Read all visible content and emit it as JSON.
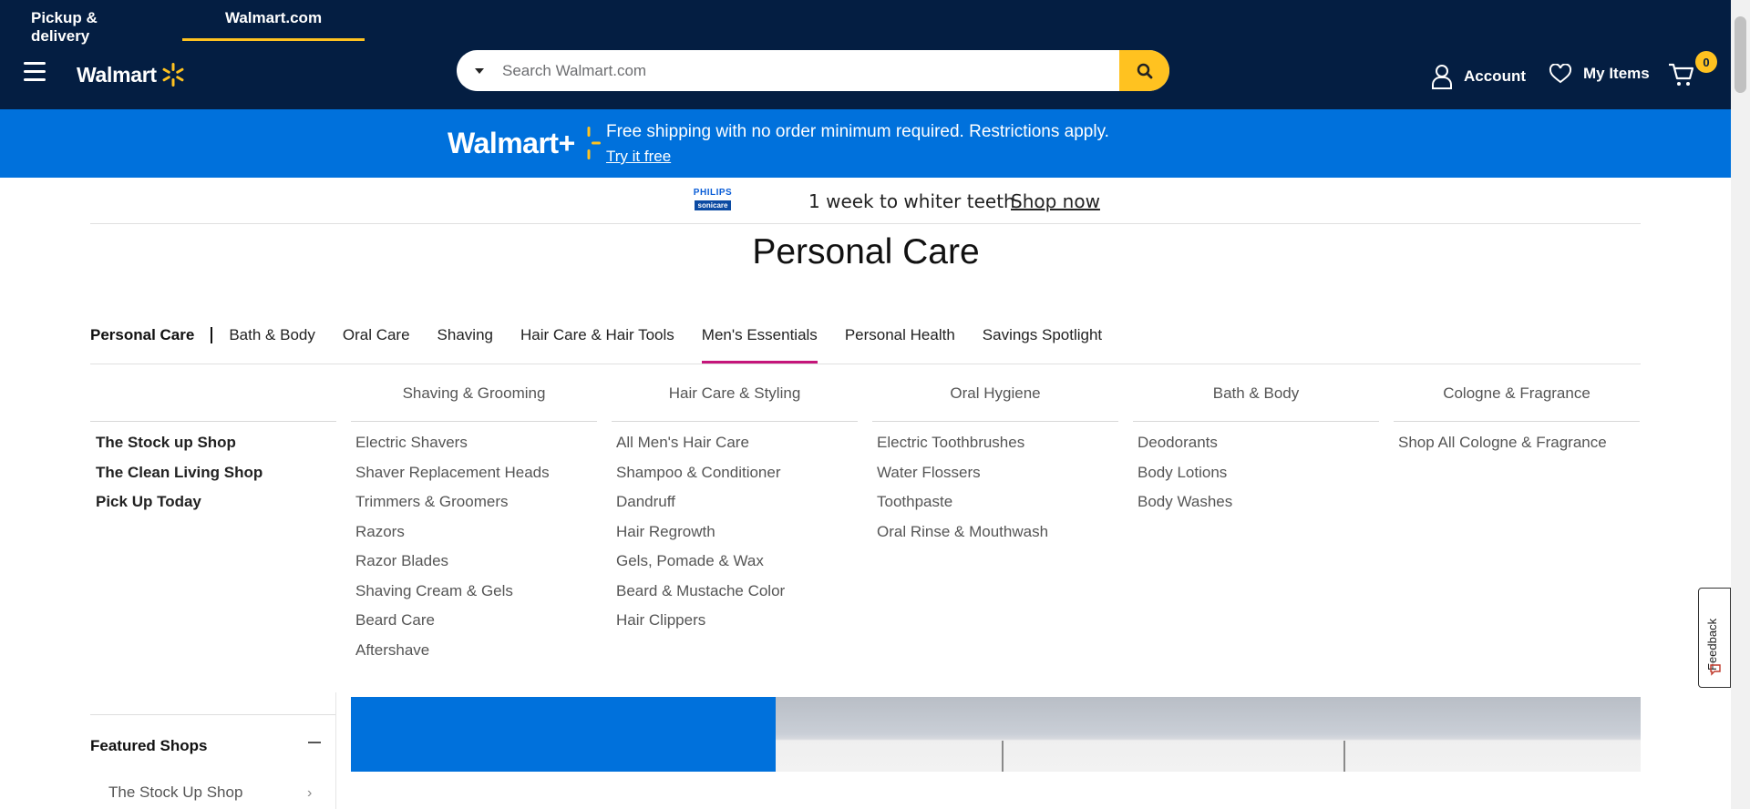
{
  "header": {
    "tabs": [
      {
        "label": "Pickup & delivery"
      },
      {
        "label": "Walmart.com"
      }
    ],
    "brand": "Walmart",
    "search_placeholder": "Search Walmart.com",
    "account_label": "Account",
    "my_items_label": "My Items",
    "cart_count": "0",
    "colors": {
      "navy": "#041e42",
      "yellow": "#ffc220",
      "blue": "#0071dc"
    }
  },
  "promo": {
    "logo_text": "Walmart+",
    "message": "Free shipping with no order minimum required. Restrictions apply.",
    "link": "Try it free"
  },
  "ad": {
    "brand_line1": "PHILIPS",
    "brand_line2": "sonicare",
    "text": "1 week to whiter teeth",
    "link": "Shop now"
  },
  "page_title": "Personal Care",
  "category_nav": {
    "root": "Personal Care",
    "items": [
      "Bath & Body",
      "Oral Care",
      "Shaving",
      "Hair Care & Hair Tools",
      "Men's Essentials",
      "Personal Health",
      "Savings Spotlight"
    ],
    "active": "Men's Essentials"
  },
  "mega_menu": {
    "side_links": [
      "The Stock up Shop",
      "The Clean Living Shop",
      "Pick Up Today"
    ],
    "columns": [
      {
        "heading": "Shaving & Grooming",
        "items": [
          "Electric Shavers",
          "Shaver Replacement Heads",
          "Trimmers & Groomers",
          "Razors",
          "Razor Blades",
          "Shaving Cream & Gels",
          "Beard Care",
          "Aftershave"
        ]
      },
      {
        "heading": "Hair Care & Styling",
        "items": [
          "All Men's Hair Care",
          "Shampoo & Conditioner",
          "Dandruff",
          "Hair Regrowth",
          "Gels, Pomade & Wax",
          "Beard & Mustache Color",
          "Hair Clippers"
        ]
      },
      {
        "heading": "Oral Hygiene",
        "items": [
          "Electric Toothbrushes",
          "Water Flossers",
          "Toothpaste",
          "Oral Rinse & Mouthwash"
        ]
      },
      {
        "heading": "Bath & Body",
        "items": [
          "Deodorants",
          "Body Lotions",
          "Body Washes"
        ]
      },
      {
        "heading": "Cologne & Fragrance",
        "items": [
          "Shop All Cologne & Fragrance"
        ]
      }
    ]
  },
  "sidebar": {
    "featured_title": "Featured Shops",
    "featured_item": "The Stock Up Shop"
  },
  "feedback_label": "Feedback"
}
